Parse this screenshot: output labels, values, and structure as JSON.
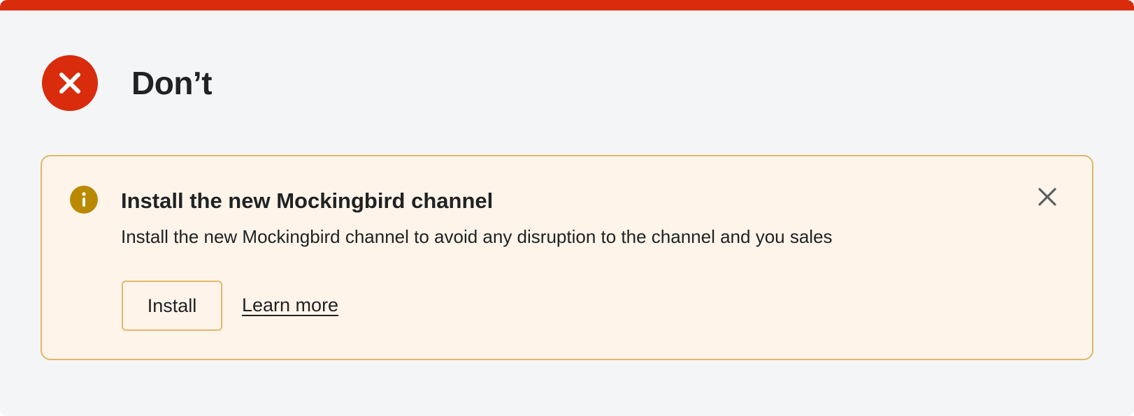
{
  "header": {
    "status_icon": "x-circle-icon",
    "title": "Don’t"
  },
  "banner": {
    "icon": "info-icon",
    "title": "Install the new Mockingbird channel",
    "body": "Install the new Mockingbird channel to avoid any disruption to the channel and you sales",
    "primary_action": "Install",
    "secondary_action": "Learn more",
    "dismiss_icon": "close-icon"
  },
  "colors": {
    "critical": "#d82c0d",
    "background": "#f4f5f7",
    "banner_background": "#fef4ea",
    "banner_border": "#e3b76a",
    "warning_icon": "#b98900",
    "text": "#202223"
  }
}
